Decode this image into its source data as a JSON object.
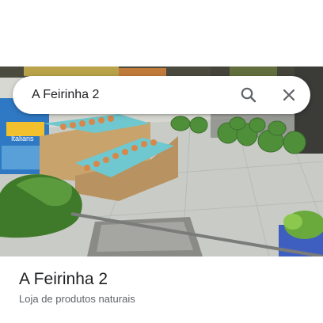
{
  "search": {
    "query": "A Feirinha 2"
  },
  "place": {
    "name": "A Feirinha 2",
    "category": "Loja de produtos naturais"
  },
  "photo": {
    "sign_text": "Italians"
  },
  "icons": {
    "search": "search-icon",
    "close": "close-icon"
  },
  "colors": {
    "title": "#202124",
    "subtitle": "#5f6368",
    "icon": "#5f6368"
  }
}
